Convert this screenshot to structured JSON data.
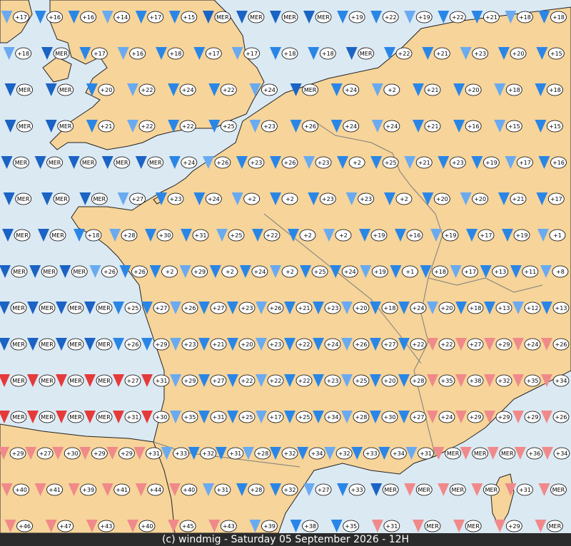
{
  "footer": {
    "credit": "(c) windmig - Saturday 05 September 2026 - 12H"
  },
  "colors": {
    "sea": "#dbe9f3",
    "land": "#f6d49a",
    "border": "#7d7d7d",
    "coast": "#222222",
    "wind_light": "#6aaaf0",
    "wind_medium": "#2a86e6",
    "wind_strong": "#1b63c4",
    "wind_pink": "#f08a8a",
    "wind_red": "#e53a3a",
    "footer_bg": "#2b2b2b"
  },
  "map": {
    "legend_sea_label": "MER",
    "rows": [
      {
        "temps": [
          "+17",
          "+16",
          "+16",
          "+14",
          "+17",
          "+15",
          "MER",
          "MER",
          "MER",
          "MER",
          "+19",
          "+22",
          "+19",
          "+22",
          "+21",
          "+18",
          "+18"
        ]
      },
      {
        "temps": [
          "+18",
          "MER",
          "+17",
          "+16",
          "+18",
          "+17",
          "+17",
          "+18",
          "+18",
          "MER",
          "+22",
          "+21",
          "+23",
          "+20",
          "+15"
        ]
      },
      {
        "temps": [
          "MER",
          "MER",
          "+20",
          "+22",
          "+24",
          "+22",
          "+24",
          "MER",
          "+24",
          "+2",
          "+21",
          "+20",
          "+18",
          "+18"
        ]
      },
      {
        "temps": [
          "MER",
          "MER",
          "+21",
          "+22",
          "+22",
          "+25",
          "+23",
          "+26",
          "+24",
          "+24",
          "+21",
          "+16",
          "+15",
          "+15"
        ]
      },
      {
        "temps": [
          "MER",
          "MER",
          "MER",
          "MER",
          "MER",
          "+24",
          "+26",
          "+23",
          "+26",
          "+23",
          "+2",
          "+25",
          "+21",
          "+23",
          "+19",
          "+17",
          "+16"
        ]
      },
      {
        "temps": [
          "MER",
          "MER",
          "MER",
          "+27",
          "+23",
          "+24",
          "+2",
          "+2",
          "+23",
          "+23",
          "+2",
          "+20",
          "+20",
          "+21",
          "+17"
        ]
      },
      {
        "temps": [
          "MER",
          "MER",
          "+18",
          "+28",
          "+30",
          "+31",
          "+25",
          "+22",
          "+2",
          "+2",
          "+19",
          "+16",
          "+19",
          "+17",
          "+19",
          "+1"
        ]
      },
      {
        "temps": [
          "MER",
          "MER",
          "MER",
          "+26",
          "+26",
          "+2",
          "+29",
          "+2",
          "+24",
          "+2",
          "+25",
          "+24",
          "+19",
          "+1",
          "+18",
          "+17",
          "+13",
          "+11",
          "+8"
        ]
      },
      {
        "temps": [
          "MER",
          "MER",
          "MER",
          "MER",
          "+25",
          "+27",
          "+26",
          "+27",
          "+23",
          "+26",
          "+21",
          "+23",
          "+20",
          "+18",
          "+24",
          "+20",
          "+18",
          "+13",
          "+12",
          "+13"
        ]
      },
      {
        "temps": [
          "MER",
          "MER",
          "MER",
          "MER",
          "+26",
          "+29",
          "+23",
          "+21",
          "+20",
          "+23",
          "+22",
          "+24",
          "+26",
          "+27",
          "+22",
          "+22",
          "+27",
          "+29",
          "+24",
          "+26"
        ]
      },
      {
        "temps": [
          "MER",
          "MER",
          "MER",
          "MER",
          "+27",
          "+31",
          "+29",
          "+27",
          "+22",
          "+22",
          "+22",
          "+23",
          "+25",
          "+20",
          "+28",
          "+35",
          "+38",
          "+32",
          "+35",
          "+34"
        ]
      },
      {
        "temps": [
          "MER",
          "MER",
          "MER",
          "MER",
          "+31",
          "+30",
          "+35",
          "+31",
          "+25",
          "+17",
          "+25",
          "+34",
          "+28",
          "+30",
          "+27",
          "+24",
          "+29",
          "+29",
          "+29",
          "+26"
        ]
      },
      {
        "temps": [
          "+29",
          "+27",
          "+30",
          "+29",
          "+29",
          "+31",
          "+33",
          "+32",
          "+31",
          "+28",
          "+32",
          "+34",
          "+32",
          "+33",
          "+34",
          "+31",
          "MER",
          "MER",
          "MER",
          "+36",
          "+34"
        ]
      },
      {
        "temps": [
          "+40",
          "+41",
          "+39",
          "+41",
          "+44",
          "+40",
          "+31",
          "+28",
          "+32",
          "+27",
          "+33",
          "MER",
          "MER",
          "MER",
          "MER",
          "+31",
          "MER"
        ]
      },
      {
        "temps": [
          "+46",
          "+47",
          "+43",
          "+40",
          "+45",
          "+43",
          "+39",
          "+38",
          "+35",
          "+31",
          "MER",
          "MER",
          "+29",
          "MER"
        ]
      }
    ]
  }
}
